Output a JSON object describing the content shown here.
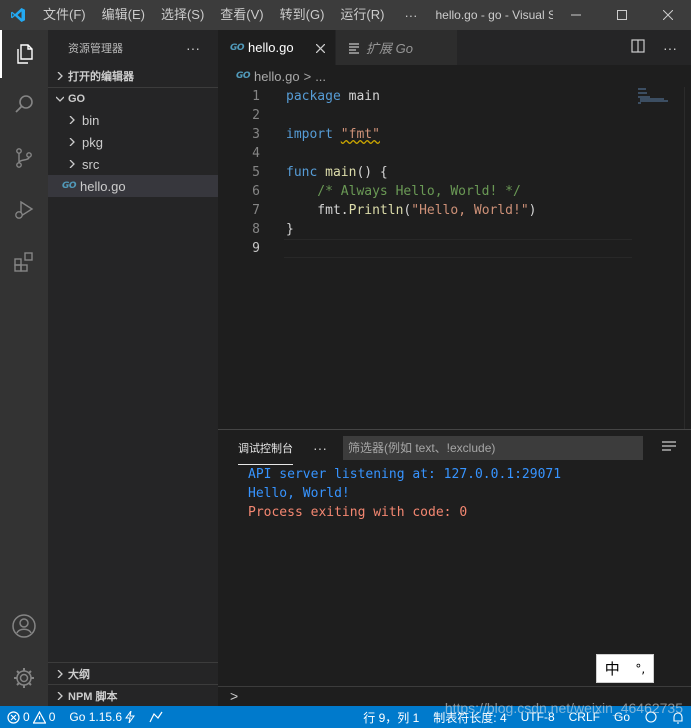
{
  "titlebar": {
    "menu": [
      "文件(F)",
      "编辑(E)",
      "选择(S)",
      "查看(V)",
      "转到(G)",
      "运行(R)"
    ],
    "more": "···",
    "window_title": "hello.go - go - Visual St..."
  },
  "activitybar": {
    "icons": [
      "files-icon",
      "search-icon",
      "source-control-icon",
      "run-debug-icon",
      "extensions-icon",
      "account-icon",
      "settings-gear-icon"
    ]
  },
  "sidebar": {
    "title": "资源管理器",
    "more": "···",
    "open_editors": "打开的编辑器",
    "folder": "GO",
    "items": [
      {
        "label": "bin",
        "type": "folder"
      },
      {
        "label": "pkg",
        "type": "folder"
      },
      {
        "label": "src",
        "type": "folder"
      },
      {
        "label": "hello.go",
        "type": "file",
        "badge": "GO"
      }
    ],
    "outline": "大纲",
    "npm": "NPM 脚本"
  },
  "tabs": [
    {
      "label": "hello.go",
      "badge": "GO",
      "active": true
    },
    {
      "label": "扩展 Go",
      "active": false
    }
  ],
  "breadcrumb": {
    "file": "hello.go",
    "sep": ">",
    "more": "..."
  },
  "editor": {
    "line_numbers": [
      "1",
      "2",
      "3",
      "4",
      "5",
      "6",
      "7",
      "8",
      "9"
    ],
    "lines": {
      "l1_kw": "package",
      "l1_rest": " main",
      "l3_kw": "import",
      "l3_str": "\"fmt\"",
      "l5_kw": "func",
      "l5_fn": " main",
      "l5_rest": "() {",
      "l6": "    /* Always Hello, World! */",
      "l7_pre": "    fmt.",
      "l7_fn": "Println",
      "l7_open": "(",
      "l7_str": "\"Hello, World!\"",
      "l7_close": ")",
      "l8": "}"
    }
  },
  "panel": {
    "tab": "调试控制台",
    "more": "···",
    "filter_placeholder": "筛选器(例如 text、!exclude)",
    "output": [
      {
        "text": "API server listening at: 127.0.0.1:29071",
        "color": "#3794ff"
      },
      {
        "text": "Hello, World!",
        "color": "#3794ff"
      },
      {
        "text": "Process exiting with code: 0",
        "color": "#f48771"
      }
    ],
    "repl_prompt": ">"
  },
  "ime": {
    "mode": "中",
    "punct": "°,"
  },
  "statusbar": {
    "errors": "0",
    "warnings": "0",
    "go_version": "Go 1.15.6",
    "position": "行 9，列 1",
    "tab_size": "制表符长度: 4",
    "encoding": "UTF-8",
    "eol": "CRLF",
    "language": "Go",
    "bg": "#007acc"
  },
  "watermark": "https://blog.csdn.net/weixin_46462735"
}
